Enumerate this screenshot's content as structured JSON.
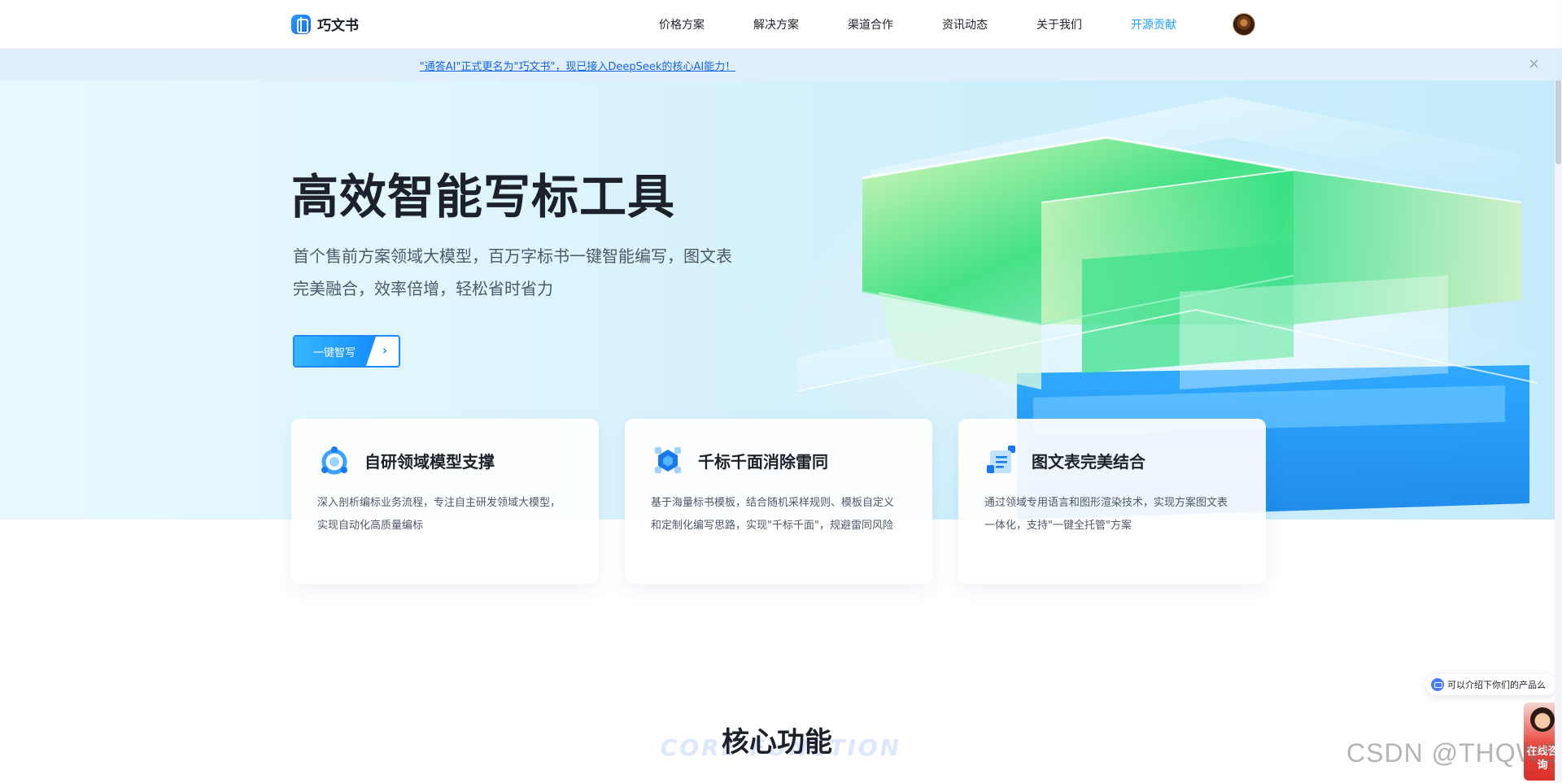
{
  "brand": {
    "name": "巧文书",
    "accent": "#1e9bff"
  },
  "nav": {
    "links": [
      "价格方案",
      "解决方案",
      "渠道合作",
      "资讯动态",
      "关于我们",
      "开源贡献"
    ],
    "active_index": 5
  },
  "notice": {
    "text": "\"通答AI\"正式更名为\"巧文书\"，现已接入DeepSeek的核心AI能力！",
    "close_icon": "×"
  },
  "hero": {
    "title": "高效智能写标工具",
    "subtitle_line1": "首个售前方案领域大模型，百万字标书一键智能编写，图文表",
    "subtitle_line2": "完美融合，效率倍增，轻松省时省力",
    "cta_label": "一键智写",
    "cta_arrow": "›"
  },
  "features": [
    {
      "icon": "model-icon",
      "title": "自研领域模型支撑",
      "desc": "深入剖析编标业务流程，专注自主研发领域大模型，实现自动化高质量编标"
    },
    {
      "icon": "cube-icon",
      "title": "千标千面消除雷同",
      "desc": "基于海量标书模板，结合随机采样规则、模板自定义和定制化编写思路，实现\"千标千面\"，规避雷同风险"
    },
    {
      "icon": "document-icon",
      "title": "图文表完美结合",
      "desc": "通过领域专用语言和图形渲染技术，实现方案图文表一体化，支持\"一键全托管\"方案"
    }
  ],
  "core": {
    "title": "核心功能",
    "ghost": "CORE FUNCTION"
  },
  "widgets": {
    "chat_prompt": "可以介绍下你们的产品么",
    "consult_label": "在线咨询"
  },
  "watermark": "CSDN @THQWS"
}
